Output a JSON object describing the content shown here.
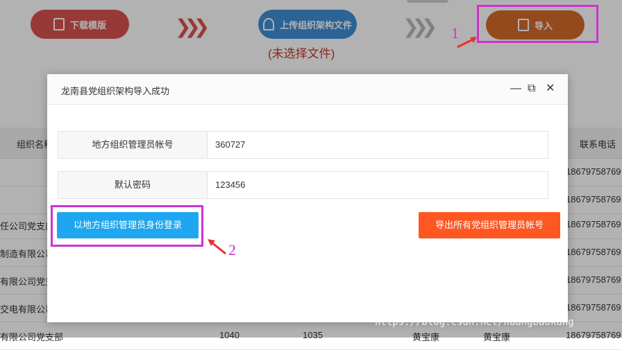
{
  "toolbar": {
    "download_label": "下载模版",
    "upload_label": "上传组织架构文件",
    "import_label": "导入",
    "no_file": "(未选择文件)"
  },
  "annotations": {
    "one": "1",
    "two": "2"
  },
  "table": {
    "headers": [
      "组织名称",
      "联系电话"
    ],
    "rows": [
      {
        "name": "",
        "phone": "18679758769"
      },
      {
        "name": "",
        "phone": "18679758769"
      },
      {
        "name": "任公司党支部",
        "phone": "18679758769"
      },
      {
        "name": "制造有限公司",
        "phone": "18679758769"
      },
      {
        "name": "有限公司党支",
        "phone": "18679758769"
      },
      {
        "name": "交电有限公司",
        "phone": "18679758769"
      },
      {
        "name": "有限公司党支部",
        "c1": "1040",
        "c2": "1035",
        "c3": "黄宝康",
        "c4": "黄宝康",
        "phone": "18679758769"
      }
    ]
  },
  "modal": {
    "title": "龙南县党组织架构导入成功",
    "account_label": "地方组织管理员帐号",
    "account_value": "360727",
    "password_label": "默认密码",
    "password_value": "123456",
    "login_button": "以地方组织管理员身份登录",
    "export_button": "导出所有党组织管理员帐号"
  },
  "watermark": "https://blog.csdn.net/huangbaokang",
  "colors": {
    "accent_blue": "#1ea7f0",
    "accent_orange": "#ff5722",
    "annotation": "#cc33cc"
  }
}
